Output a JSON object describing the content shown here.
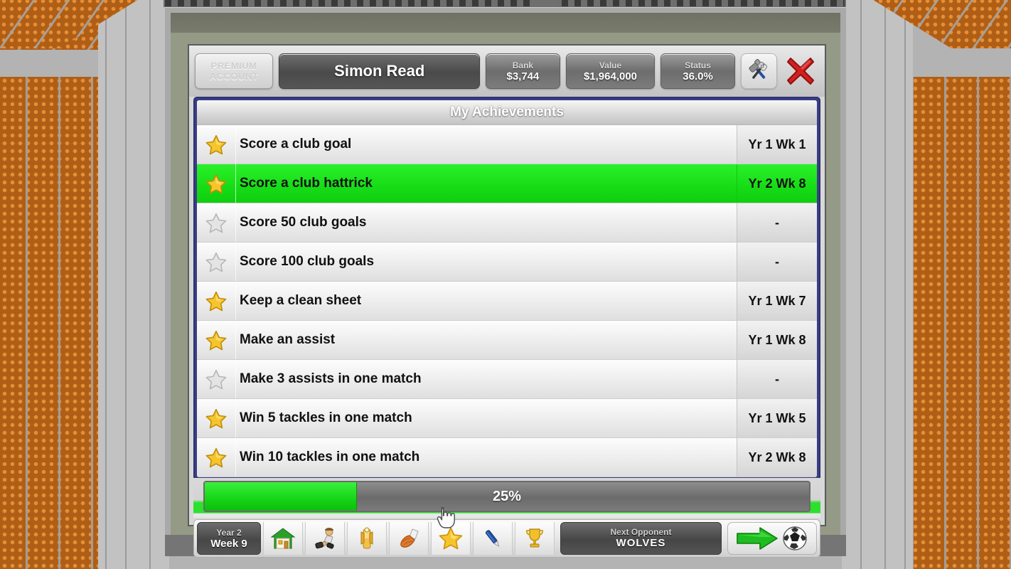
{
  "header": {
    "premium_line1": "PREMIUM",
    "premium_line2": "ACCOUNT",
    "player_name": "Simon Read",
    "stats": [
      {
        "label": "Bank",
        "value": "$3,744"
      },
      {
        "label": "Value",
        "value": "$1,964,000"
      },
      {
        "label": "Status",
        "value": "36.0%"
      }
    ],
    "tools_icon": "hammer-wrench-icon",
    "close_icon": "close-x-icon"
  },
  "panel": {
    "title": "My Achievements",
    "rows": [
      {
        "name": "Score a club goal",
        "date": "Yr 1 Wk 1",
        "earned": true,
        "highlight": false
      },
      {
        "name": "Score a club hattrick",
        "date": "Yr 2 Wk 8",
        "earned": true,
        "highlight": true
      },
      {
        "name": "Score 50 club goals",
        "date": "-",
        "earned": false,
        "highlight": false
      },
      {
        "name": "Score 100 club goals",
        "date": "-",
        "earned": false,
        "highlight": false
      },
      {
        "name": "Keep a clean sheet",
        "date": "Yr 1 Wk 7",
        "earned": true,
        "highlight": false
      },
      {
        "name": "Make an assist",
        "date": "Yr 1 Wk 8",
        "earned": true,
        "highlight": false
      },
      {
        "name": "Make 3 assists in one match",
        "date": "-",
        "earned": false,
        "highlight": false
      },
      {
        "name": "Win 5 tackles in one match",
        "date": "Yr 1 Wk 5",
        "earned": true,
        "highlight": false
      },
      {
        "name": "Win 10 tackles in one match",
        "date": "Yr 2 Wk 8",
        "earned": true,
        "highlight": false
      }
    ]
  },
  "progress": {
    "percent_label": "25%",
    "percent": 25,
    "fill_color": "#15d415",
    "track_color": "#6b6b6b"
  },
  "toolbar": {
    "year_label": "Year 2",
    "week_label": "Week 9",
    "icons": [
      {
        "name": "home-icon",
        "glyph": "home"
      },
      {
        "name": "player-icon",
        "glyph": "player"
      },
      {
        "name": "squad-icon",
        "glyph": "squad"
      },
      {
        "name": "boots-icon",
        "glyph": "boots"
      },
      {
        "name": "star-icon",
        "glyph": "star"
      },
      {
        "name": "pen-icon",
        "glyph": "pen"
      },
      {
        "name": "trophy-icon",
        "glyph": "trophy"
      }
    ],
    "selected_icon": "star-icon",
    "next_opponent_label": "Next Opponent",
    "next_opponent_value": "WOLVES",
    "continue_icon": "green-arrow-icon",
    "ball_icon": "football-icon"
  },
  "colors": {
    "panel_border": "#3a3e86",
    "highlight_green": "#16dc16",
    "accent_red": "#d41f1f",
    "seat_orange": "#e68f33"
  }
}
